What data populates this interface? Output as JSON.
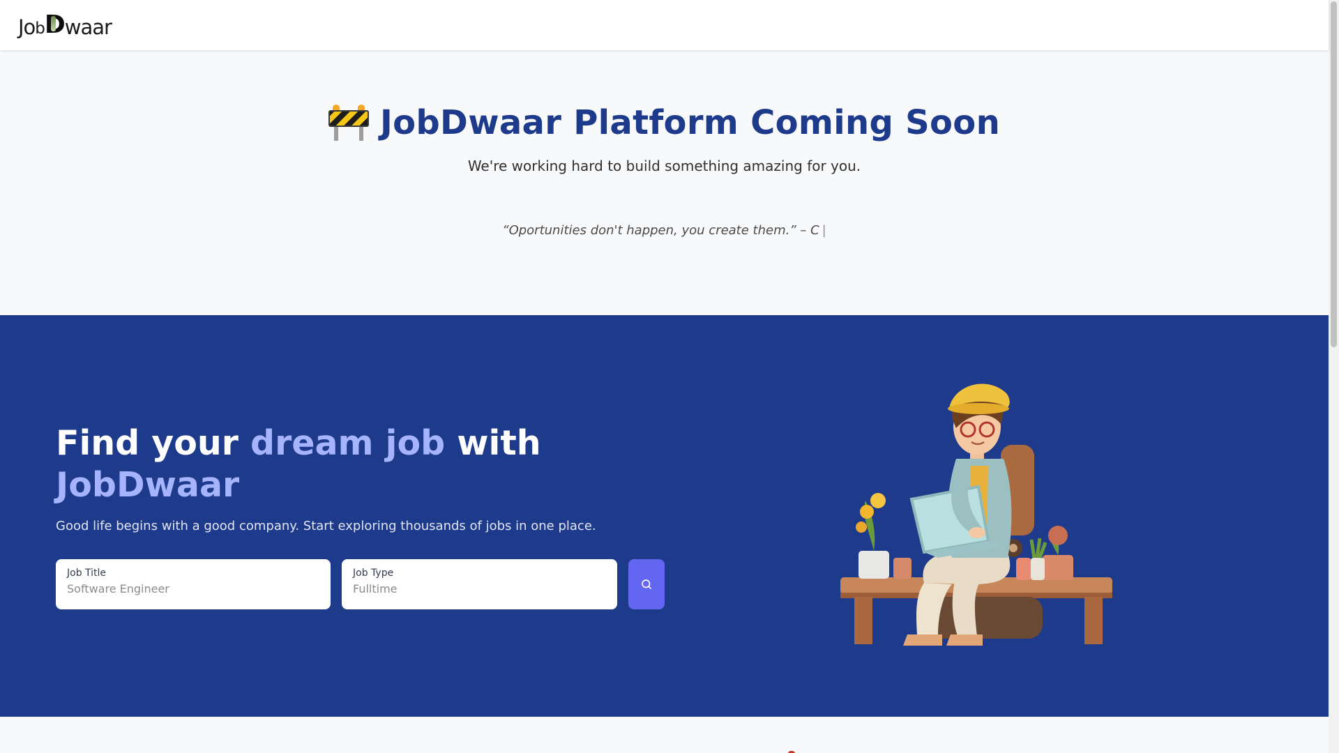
{
  "header": {
    "logo": {
      "part1": "Jo",
      "part2": "b",
      "part3": "D",
      "part4": "waar"
    }
  },
  "coming_soon": {
    "heading": "JobDwaar Platform Coming Soon",
    "icon": "construction-barrier-icon",
    "subtitle": "We're working hard to build something amazing for you.",
    "quote": "“Oportunities don't happen, you create them.” – C",
    "caret": "|"
  },
  "hero": {
    "title_part1": "Find your ",
    "title_accent1": "dream job",
    "title_part2": " with",
    "title_accent2": "JobDwaar",
    "description": "Good life begins with a good company. Start exploring thousands of jobs in one place.",
    "job_title": {
      "label": "Job Title",
      "placeholder": "Software Engineer"
    },
    "job_type": {
      "label": "Job Type",
      "placeholder": "Fulltime"
    },
    "search_icon": "search-icon",
    "illustration": "developer-with-laptop-illustration"
  },
  "colors": {
    "primary": "#1e3a8a",
    "accent_text": "#a5b4fc",
    "button": "#6366f1",
    "background": "#f8f9fb"
  }
}
